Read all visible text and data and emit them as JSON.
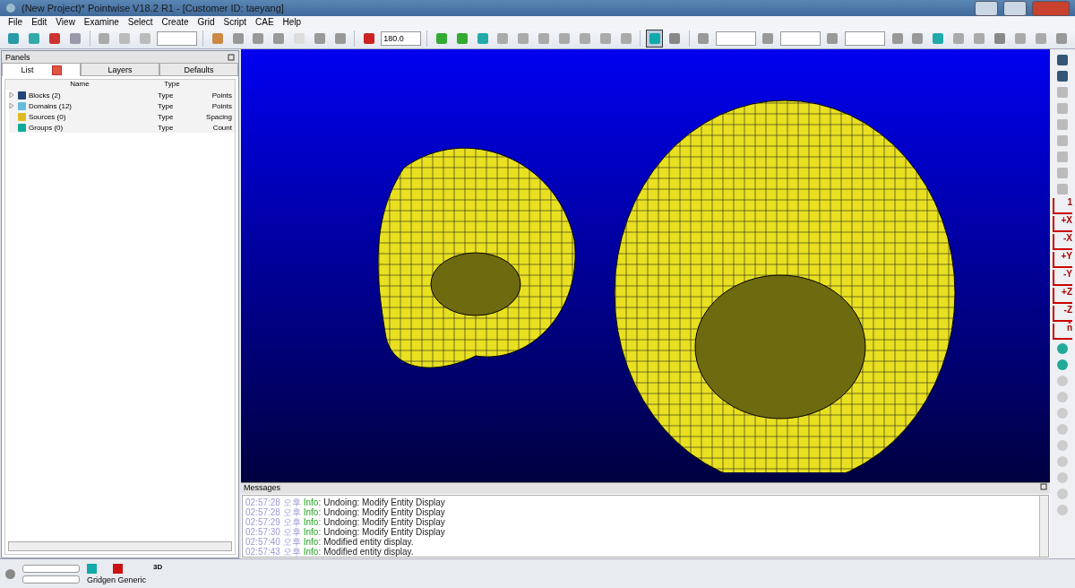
{
  "window": {
    "title": "(New Project)* Pointwise V18.2 R1 - [Customer ID: taeyang]"
  },
  "menu": [
    "File",
    "Edit",
    "View",
    "Examine",
    "Select",
    "Create",
    "Grid",
    "Script",
    "CAE",
    "Help"
  ],
  "toolbar": {
    "angle": "180.0",
    "grid_display_selected": true
  },
  "panels": {
    "title": "Panels",
    "tabs": [
      {
        "label": "List",
        "selected": true
      },
      {
        "label": "Layers",
        "selected": false
      },
      {
        "label": "Defaults",
        "selected": false
      }
    ],
    "columns": [
      "Name",
      "Type"
    ],
    "rows": [
      {
        "kind": "block",
        "name": "Blocks (2)",
        "type": "Type",
        "value": "Points",
        "expanded": false
      },
      {
        "kind": "domain",
        "name": "Domains (12)",
        "type": "Type",
        "value": "Points",
        "expanded": false
      },
      {
        "kind": "source",
        "name": "Sources (0)",
        "type": "Type",
        "value": "Spacing"
      },
      {
        "kind": "group",
        "name": "Groups (0)",
        "type": "Type",
        "value": "Count"
      }
    ]
  },
  "axis_buttons": [
    "1",
    "+X",
    "-X",
    "+Y",
    "-Y",
    "+Z",
    "-Z",
    "n̂"
  ],
  "messages": {
    "title": "Messages",
    "lines": [
      {
        "time": "02:57:28 오후",
        "level": "Info:",
        "text": "Undoing: Modify Entity Display"
      },
      {
        "time": "02:57:28 오후",
        "level": "Info:",
        "text": "Undoing: Modify Entity Display"
      },
      {
        "time": "02:57:29 오후",
        "level": "Info:",
        "text": "Undoing: Modify Entity Display"
      },
      {
        "time": "02:57:30 오후",
        "level": "Info:",
        "text": "Undoing: Modify Entity Display"
      },
      {
        "time": "02:57:40 오후",
        "level": "Info:",
        "text": "Modified entity display."
      },
      {
        "time": "02:57:43 오후",
        "level": "Info:",
        "text": "Modified entity display."
      }
    ]
  },
  "status": {
    "progress": [
      {
        "level": 0
      },
      {
        "level": 0
      }
    ],
    "solver": "Gridgen Generic",
    "dimension": "3D"
  }
}
